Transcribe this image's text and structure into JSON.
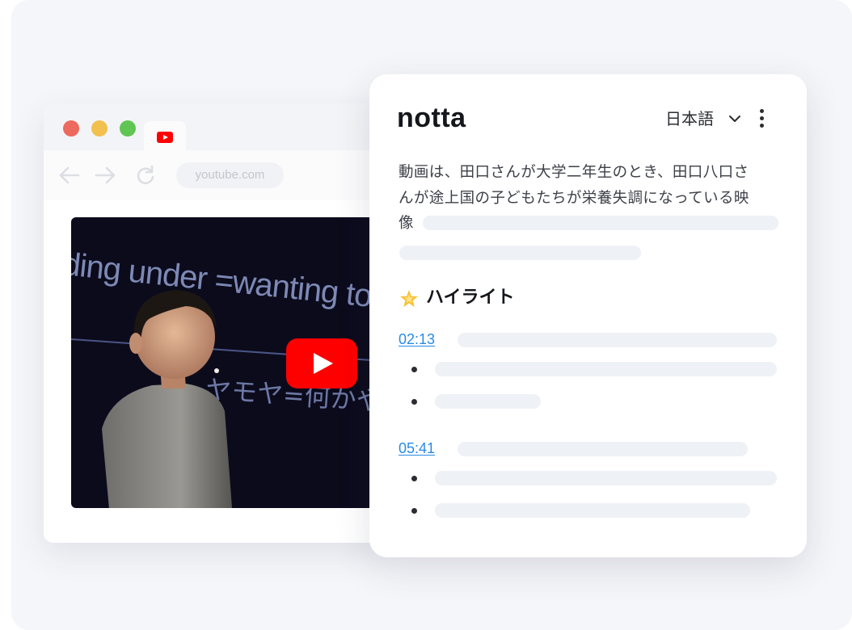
{
  "browser": {
    "tab_icon": "youtube-icon",
    "url": "youtube.com",
    "nav_icons": [
      "arrow-left-icon",
      "arrow-right-icon",
      "reload-icon"
    ]
  },
  "video": {
    "slide_text_1": "ding under =wanting to a",
    "slide_text_2": "ヤモヤ=何かやりた",
    "play_icon": "play-button-icon"
  },
  "panel": {
    "brand": "notta",
    "language": "日本語",
    "transcript_lines": [
      "動画は、田口さんが大学二年生のとき、田口八口さ",
      "んが途上国の子どもたちが栄養失調になっている映",
      "像"
    ],
    "highlight_title": "ハイライト",
    "highlights": [
      {
        "time": "02:13"
      },
      {
        "time": "05:41"
      }
    ]
  },
  "colors": {
    "accent_link": "#2a8ae6",
    "youtube_red": "#ff0000",
    "skeleton": "#eef1f6",
    "background": "#f5f6f9"
  }
}
